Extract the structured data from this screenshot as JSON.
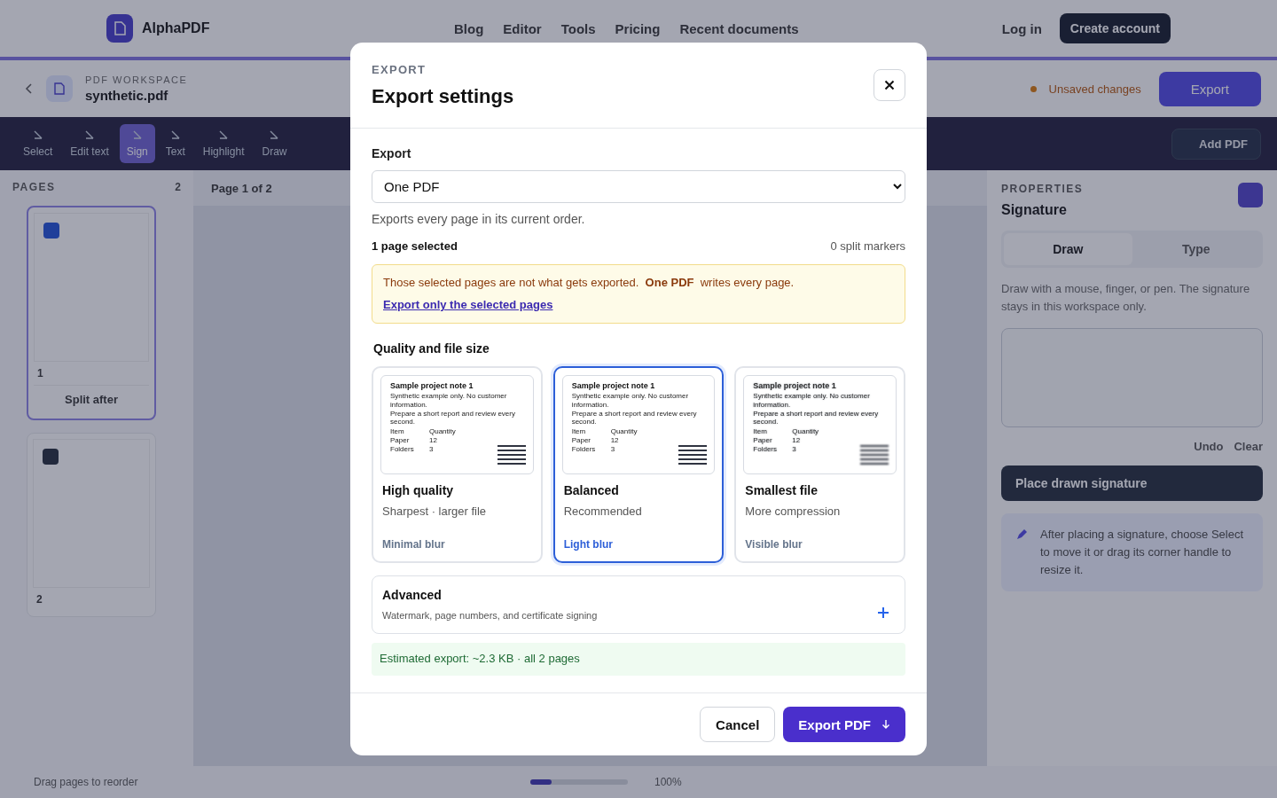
{
  "background": {
    "brand": "AlphaPDF",
    "nav": [
      "Blog",
      "Editor",
      "Tools",
      "Pricing",
      "Recent documents"
    ],
    "login": "Log in",
    "create_account": "Create account",
    "workspace_label": "PDF WORKSPACE",
    "file_name": "synthetic.pdf",
    "unsaved": "Unsaved changes",
    "export_button": "Export",
    "tools": [
      {
        "label": "Select",
        "selected": false
      },
      {
        "label": "Edit text",
        "selected": false
      },
      {
        "label": "Sign",
        "selected": true
      },
      {
        "label": "Text",
        "selected": false
      },
      {
        "label": "Highlight",
        "selected": false
      },
      {
        "label": "Draw",
        "selected": false
      }
    ],
    "add_pdf": "Add PDF",
    "pages_title": "PAGES",
    "pages_count": "2",
    "pages": [
      {
        "number": "1",
        "selected": true,
        "split_label": "Split after"
      },
      {
        "number": "2",
        "selected": false
      }
    ],
    "page_indicator": "Page 1 of 2",
    "reorder_hint": "Drag pages to reorder",
    "zoom": {
      "level": 0.22,
      "reading": "100%"
    },
    "properties_label": "PROPERTIES",
    "properties_title": "Signature",
    "sign_tabs": [
      {
        "label": "Draw",
        "selected": true
      },
      {
        "label": "Type",
        "selected": false
      }
    ],
    "sign_hint": "Draw with a mouse, finger, or pen. The signature stays in this workspace only.",
    "undo": "Undo",
    "clear": "Clear",
    "place_button": "Place drawn signature",
    "tip": "After placing a signature, choose Select to move it or drag its corner handle to resize it."
  },
  "dialog": {
    "eyebrow": "EXPORT",
    "title": "Export settings",
    "export_label": "Export",
    "export_value": "One PDF",
    "export_hint": "Exports every page in its current order.",
    "selection_count": "1 page selected",
    "split_markers": "0 split markers",
    "warning": "Those selected pages are not what gets exported.  **One PDF**  writes every page.",
    "warning_link": "Export only the selected pages",
    "quality_title": "Quality and file size",
    "quality_options": [
      {
        "title": "High quality",
        "subtitle": "Sharpest · larger file",
        "blur_label": "Minimal blur",
        "selected": false,
        "preview_blurred": false,
        "preview": {
          "title": "Sample project note 1",
          "lines": [
            "Synthetic example only. No customer information.",
            "Prepare a short report and review every second."
          ],
          "table": [
            [
              "Item",
              "Quantity"
            ],
            [
              "Paper",
              "12"
            ],
            [
              "Folders",
              "3"
            ]
          ]
        }
      },
      {
        "title": "Balanced",
        "subtitle": "Recommended",
        "blur_label": "Light blur",
        "selected": true,
        "preview_blurred": false,
        "preview": {
          "title": "Sample project note 1",
          "lines": [
            "Synthetic example only. No customer information.",
            "Prepare a short report and review every second."
          ],
          "table": [
            [
              "Item",
              "Quantity"
            ],
            [
              "Paper",
              "12"
            ],
            [
              "Folders",
              "3"
            ]
          ]
        }
      },
      {
        "title": "Smallest file",
        "subtitle": "More compression",
        "blur_label": "Visible blur",
        "selected": false,
        "preview_blurred": true,
        "preview": {
          "title": "Sample project note 1",
          "lines": [
            "Synthetic example only. No customer information.",
            "Prepare a short report and review every second."
          ],
          "table": [
            [
              "Item",
              "Quantity"
            ],
            [
              "Paper",
              "12"
            ],
            [
              "Folders",
              "3"
            ]
          ]
        }
      }
    ],
    "advanced": {
      "title": "Advanced",
      "subtitle": "Watermark, page numbers, and certificate signing",
      "expanded": false
    },
    "estimate": "Estimated export: ~2.3 KB · all 2 pages",
    "cancel": "Cancel",
    "confirm": "Export PDF"
  }
}
